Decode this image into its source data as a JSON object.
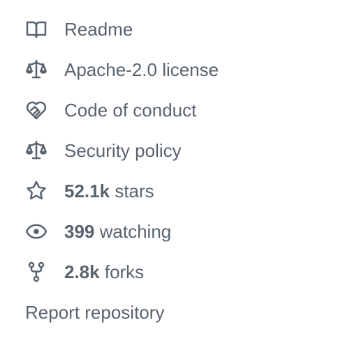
{
  "sidebar": {
    "readme": {
      "label": "Readme",
      "icon": "book-icon"
    },
    "license": {
      "label": "Apache-2.0 license",
      "icon": "law-icon"
    },
    "code_of_conduct": {
      "label": "Code of conduct",
      "icon": "code-of-conduct-icon"
    },
    "security_policy": {
      "label": "Security policy",
      "icon": "law-icon"
    },
    "stars": {
      "count": "52.1k",
      "label": "stars",
      "icon": "star-icon"
    },
    "watching": {
      "count": "399",
      "label": "watching",
      "icon": "eye-icon"
    },
    "forks": {
      "count": "2.8k",
      "label": "forks",
      "icon": "repo-forked-icon"
    },
    "report": {
      "label": "Report repository"
    }
  },
  "colors": {
    "text": "#59636e",
    "icon": "#59636e",
    "background": "#ffffff"
  }
}
